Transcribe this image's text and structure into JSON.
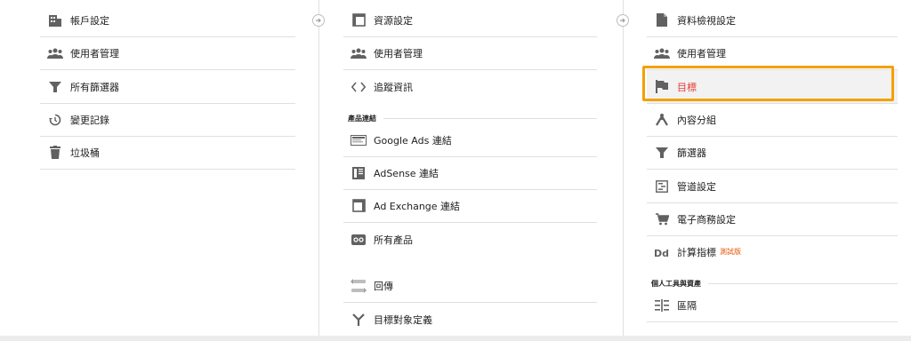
{
  "account_column": {
    "items": [
      {
        "label": "帳戶設定",
        "icon": "building-icon"
      },
      {
        "label": "使用者管理",
        "icon": "people-icon"
      },
      {
        "label": "所有篩選器",
        "icon": "filter-icon"
      },
      {
        "label": "變更記錄",
        "icon": "history-icon"
      },
      {
        "label": "垃圾桶",
        "icon": "trash-icon"
      }
    ]
  },
  "property_column": {
    "items": [
      {
        "label": "資源設定",
        "icon": "property-icon"
      },
      {
        "label": "使用者管理",
        "icon": "people-icon"
      },
      {
        "label": "追蹤資訊",
        "icon": "code-icon"
      }
    ],
    "section_label": "產品連結",
    "product_links": [
      {
        "label": "Google Ads 連結",
        "icon": "google-ads-icon"
      },
      {
        "label": "AdSense 連結",
        "icon": "adsense-icon"
      },
      {
        "label": "Ad Exchange 連結",
        "icon": "ad-exchange-icon"
      },
      {
        "label": "所有產品",
        "icon": "all-products-icon"
      }
    ],
    "more_items": [
      {
        "label": "回傳",
        "icon": "postback-icon"
      },
      {
        "label": "目標對象定義",
        "icon": "audience-icon"
      }
    ]
  },
  "view_column": {
    "items": [
      {
        "label": "資料檢視設定",
        "icon": "document-icon"
      },
      {
        "label": "使用者管理",
        "icon": "people-icon"
      },
      {
        "label": "目標",
        "icon": "flag-icon",
        "selected": true
      },
      {
        "label": "內容分組",
        "icon": "content-grouping-icon"
      },
      {
        "label": "篩選器",
        "icon": "filter-icon"
      },
      {
        "label": "管道設定",
        "icon": "channel-settings-icon"
      },
      {
        "label": "電子商務設定",
        "icon": "cart-icon"
      },
      {
        "label": "計算指標",
        "icon": "calculated-metrics-icon",
        "badge": "測試版"
      }
    ],
    "section_label": "個人工具與資產",
    "tools": [
      {
        "label": "區隔",
        "icon": "segments-icon"
      }
    ]
  },
  "colors": {
    "highlight": "#f5a000",
    "selected_text": "#e53935",
    "beta": "#e65100",
    "icon": "#616161",
    "divider": "#e0e0e0"
  }
}
